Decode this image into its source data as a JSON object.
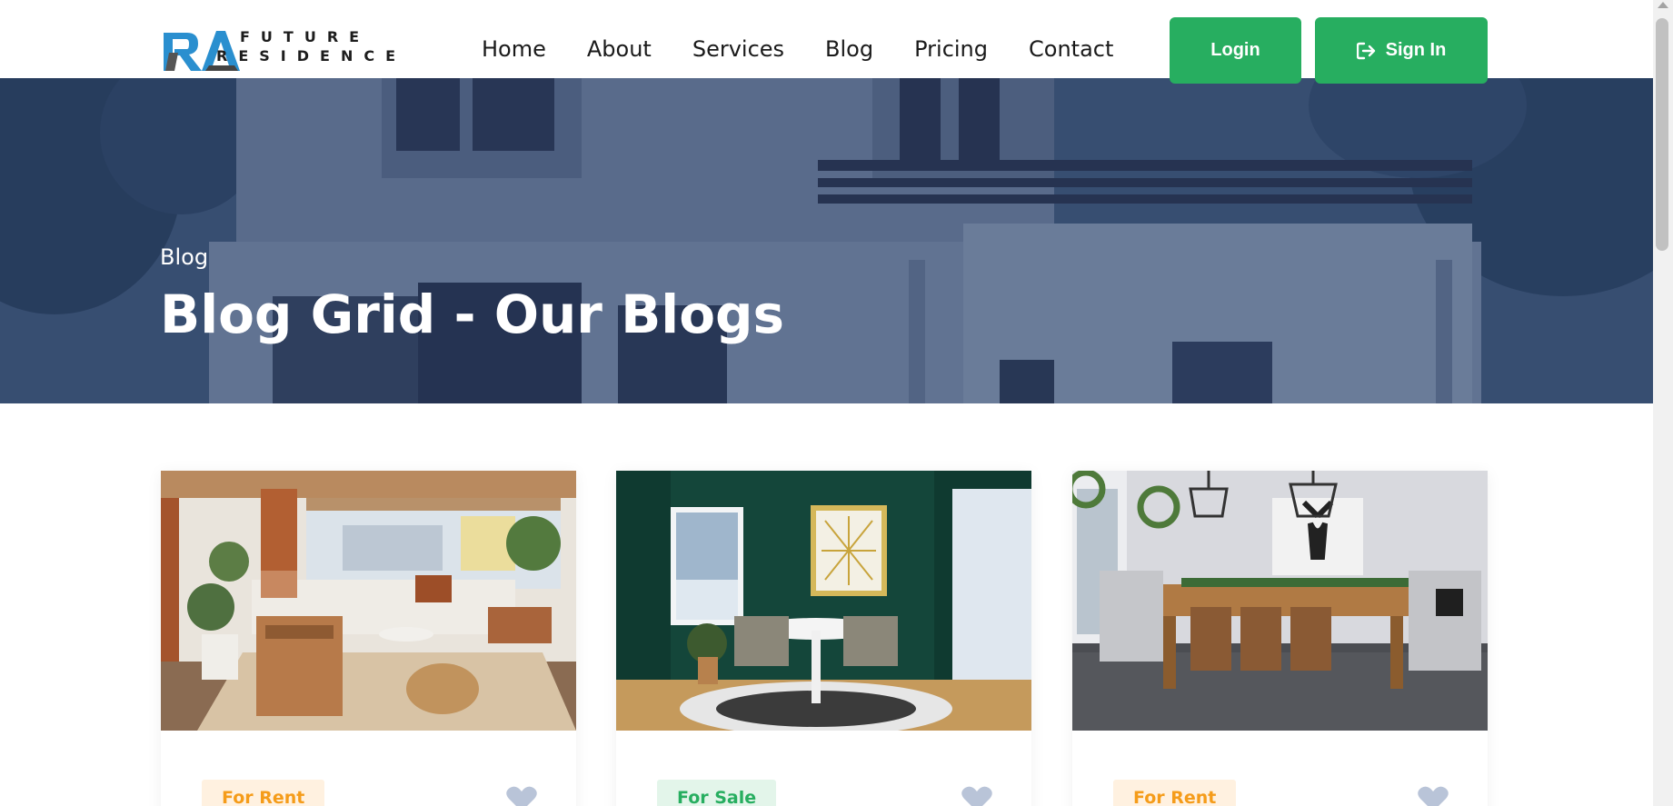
{
  "brand": {
    "name_line1": "FUTURE",
    "name_line2": "RESIDENCE",
    "mark_letters": "RA"
  },
  "nav": {
    "items": [
      "Home",
      "About",
      "Services",
      "Blog",
      "Pricing",
      "Contact"
    ]
  },
  "auth": {
    "login_label": "Login",
    "signin_label": "Sign In"
  },
  "hero": {
    "breadcrumb": "Blog",
    "title": "Blog Grid - Our Blogs"
  },
  "cards": [
    {
      "badge": "For Rent",
      "badge_type": "rent",
      "image": "living-room-photo"
    },
    {
      "badge": "For Sale",
      "badge_type": "sale",
      "image": "green-dining-nook-photo"
    },
    {
      "badge": "For Rent",
      "badge_type": "rent",
      "image": "rustic-dining-room-photo"
    }
  ],
  "colors": {
    "accent_green": "#27ae60",
    "rent_badge_text": "#f59c1a",
    "rent_badge_bg": "#fff1e0",
    "sale_badge_bg": "#e3f5ea",
    "hero_overlay": "#21375c",
    "heart": "#b9c4d8"
  }
}
